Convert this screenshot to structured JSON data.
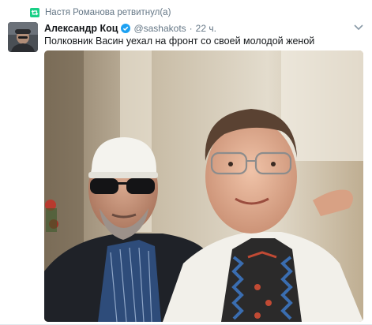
{
  "retweet": {
    "text": "Настя Романова ретвитнул(а)",
    "icon": "retweet-icon"
  },
  "tweet": {
    "author_name": "Александр Коц",
    "verified": true,
    "handle": "@sashakots",
    "separator": "·",
    "time": "22 ч.",
    "text": "Полковник Васин уехал на фронт со своей молодой женой",
    "menu_icon": "chevron-down-icon"
  },
  "colors": {
    "retweet_green": "#19cf86",
    "verified_blue": "#1da1f2",
    "secondary_text": "#657786",
    "primary_text": "#14171a"
  }
}
